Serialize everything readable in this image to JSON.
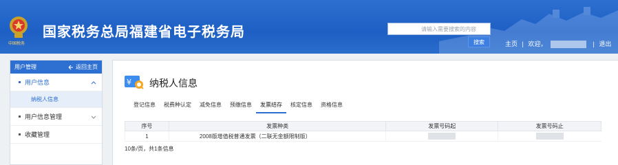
{
  "header": {
    "emblem_caption": "中国税务",
    "site_title": "国家税务总局福建省电子税务局",
    "search": {
      "placeholder": "请输入需要搜索的内容",
      "button_label": "搜索"
    },
    "links": {
      "home": "主页",
      "separator": "|",
      "welcome": "欢迎",
      "logout": "退出"
    }
  },
  "sidebar": {
    "title": "用户管理",
    "back_label": "返回主页",
    "items": [
      {
        "label": "用户信息",
        "active": true,
        "expanded": true
      },
      {
        "label": "纳税人信息",
        "sub": true
      },
      {
        "label": "用户信息管理",
        "active": false
      },
      {
        "label": "收藏管理",
        "active": false
      }
    ]
  },
  "main": {
    "title": "纳税人信息",
    "tabs": [
      {
        "label": "登记信息",
        "active": false
      },
      {
        "label": "税费种认定",
        "active": false
      },
      {
        "label": "减免信息",
        "active": false
      },
      {
        "label": "预缴信息",
        "active": false
      },
      {
        "label": "发票结存",
        "active": true
      },
      {
        "label": "核定信息",
        "active": false
      },
      {
        "label": "资格信息",
        "active": false
      }
    ],
    "table": {
      "columns": [
        "序号",
        "发票种类",
        "发票号码起",
        "发票号码止"
      ],
      "rows": [
        {
          "index": "1",
          "type": "2008版增值税普通发票（二联无金额限制版）"
        }
      ]
    },
    "pager_text": "10条/页，共1条信息"
  },
  "colors": {
    "header_blue": "#1d5fc4",
    "accent": "#2c6fd0"
  }
}
